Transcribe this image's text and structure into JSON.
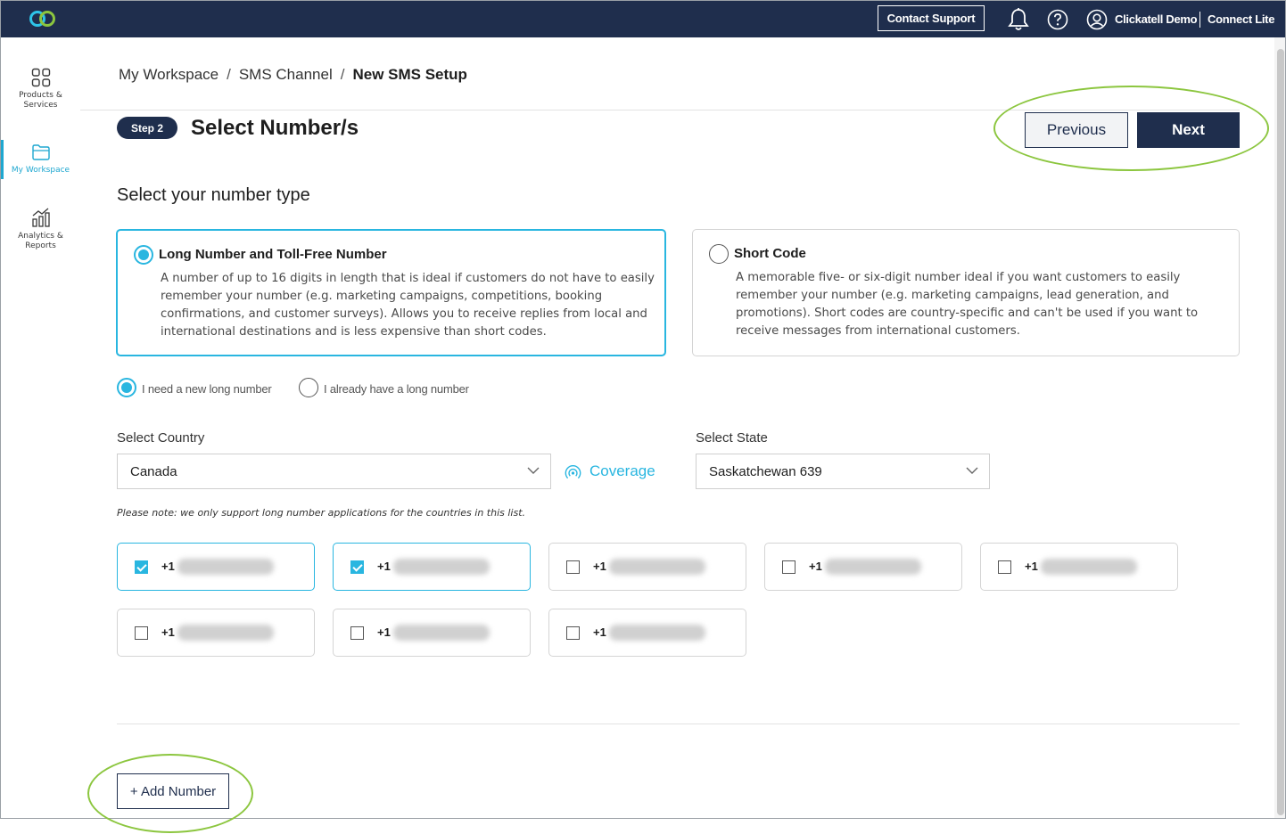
{
  "topbar": {
    "contact_label": "Contact Support",
    "user_name": "Clickatell Demo",
    "account_name": "Connect Lite"
  },
  "sidebar": {
    "items": [
      {
        "label_line1": "Products &",
        "label_line2": "Services",
        "icon": "grid-icon"
      },
      {
        "label_line1": "My Workspace",
        "label_line2": "",
        "icon": "folder-icon"
      },
      {
        "label_line1": "Analytics &",
        "label_line2": "Reports",
        "icon": "bar-chart-icon"
      }
    ]
  },
  "breadcrumb": {
    "items": [
      "My Workspace",
      "SMS Channel"
    ],
    "current": "New SMS Setup",
    "separator": "/"
  },
  "step": {
    "badge": "Step 2",
    "title": "Select Number/s",
    "prev_label": "Previous",
    "next_label": "Next"
  },
  "number_type": {
    "heading": "Select your number type",
    "options": [
      {
        "title": "Long Number and Toll-Free Number",
        "selected": true,
        "desc_lines": [
          "A number of up to 16 digits in length that is ideal if customers do not have to easily",
          "remember your number (e.g. marketing campaigns, competitions, booking",
          "confirmations, and customer surveys). Allows you to receive replies from local and",
          "international destinations and is less expensive than short codes."
        ]
      },
      {
        "title": "Short Code",
        "selected": false,
        "desc_lines": [
          "A memorable five- or six-digit number ideal if you want customers to easily",
          "remember your number (e.g. marketing campaigns, lead generation, and",
          "promotions). Short codes are country-specific and can't be used if you want to",
          "receive messages from international customers."
        ]
      }
    ]
  },
  "long_number_choice": {
    "new_label": "I need a new long number",
    "existing_label": "I already have a long number",
    "selected": "new"
  },
  "country": {
    "label": "Select Country",
    "value": "Canada",
    "coverage_label": "Coverage"
  },
  "state": {
    "label": "Select State",
    "value": "Saskatchewan 639"
  },
  "note": "Please note: we only support long number applications for the countries in this list.",
  "numbers": [
    {
      "prefix": "+1",
      "checked": true
    },
    {
      "prefix": "+1",
      "checked": true
    },
    {
      "prefix": "+1",
      "checked": false
    },
    {
      "prefix": "+1",
      "checked": false
    },
    {
      "prefix": "+1",
      "checked": false
    },
    {
      "prefix": "+1",
      "checked": false
    },
    {
      "prefix": "+1",
      "checked": false
    },
    {
      "prefix": "+1",
      "checked": false
    }
  ],
  "add_number_label": "+ Add Number",
  "colors": {
    "navy": "#1f2e4d",
    "accent": "#29b6e0",
    "highlight": "#8cc63f"
  }
}
